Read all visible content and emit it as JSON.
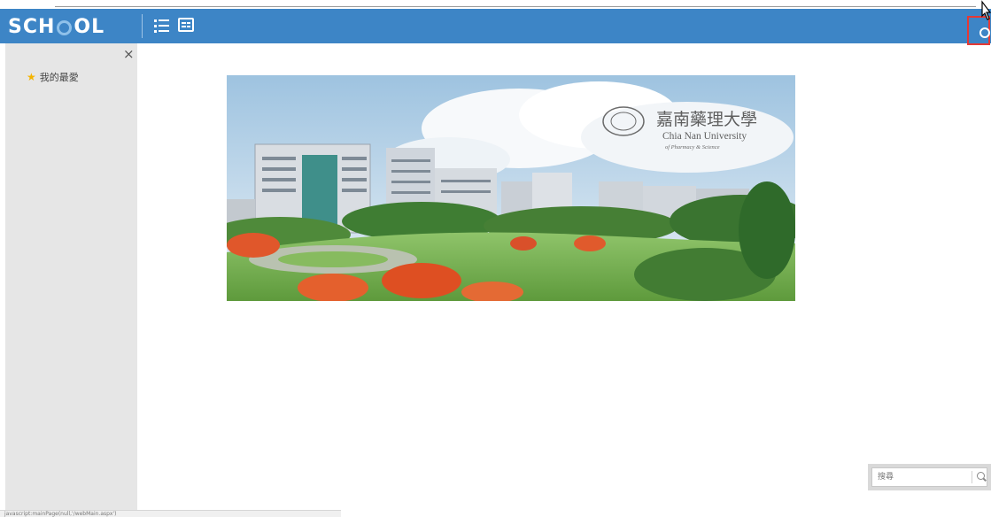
{
  "header": {
    "logo_prefix": "SCH",
    "logo_suffix": "OL",
    "accent_color": "#3d85c6",
    "menu_icon": "list-icon",
    "card_icon": "card-view-icon"
  },
  "sidebar": {
    "close_glyph": "×",
    "favorites_label": "我的最愛",
    "favorites_icon": "star-icon"
  },
  "banner": {
    "title_cn": "嘉南藥理大學",
    "title_en": "Chia Nan University",
    "subtitle_en": "of Pharmacy & Science"
  },
  "search": {
    "placeholder": "搜尋"
  },
  "status": {
    "url": "javascript:mainPage(null,'/webMain.aspx')"
  }
}
